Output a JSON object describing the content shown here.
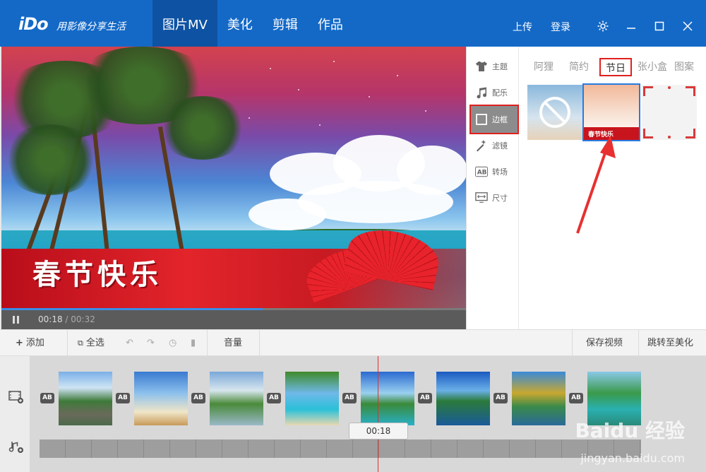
{
  "app": {
    "logo": "iDo",
    "slogan": "用影像分享生活"
  },
  "nav": {
    "tabs": [
      {
        "label": "图片MV",
        "active": true
      },
      {
        "label": "美化",
        "active": false
      },
      {
        "label": "剪辑",
        "active": false
      },
      {
        "label": "作品",
        "active": false
      }
    ]
  },
  "topbar": {
    "upload": "上传",
    "login": "登录"
  },
  "player": {
    "current_time": "00:18",
    "separator": " / ",
    "total_time": "00:32",
    "progress": 0.5625
  },
  "preview": {
    "banner_text": "春节快乐"
  },
  "panel": {
    "side_items": [
      {
        "label": "主题",
        "icon": "shirt-icon"
      },
      {
        "label": "配乐",
        "icon": "music-note-icon"
      },
      {
        "label": "边框",
        "icon": "frame-icon",
        "active": true
      },
      {
        "label": "滤镜",
        "icon": "magic-wand-icon"
      },
      {
        "label": "转场",
        "icon": "transition-ab-icon"
      },
      {
        "label": "尺寸",
        "icon": "size-icon"
      }
    ],
    "categories": [
      {
        "label": "阿狸"
      },
      {
        "label": "简约"
      },
      {
        "label": "节日",
        "active": true
      },
      {
        "label": "张小盒"
      },
      {
        "label": "图案"
      }
    ],
    "thumb_text": "春节快乐"
  },
  "toolbar": {
    "add": "添加",
    "select_all": "全选",
    "volume": "音量",
    "save_video": "保存视频",
    "goto_beautify": "跳转至美化"
  },
  "timeline": {
    "playhead_time": "00:18",
    "transition_label": "AB"
  },
  "watermark": {
    "text": "Baidu 经验",
    "url": "jingyan.baidu.com"
  },
  "colors": {
    "brand_blue": "#1469c7",
    "nav_active": "#0e52a3",
    "highlight_red": "#e02020",
    "selection_blue": "#2a7be0"
  }
}
